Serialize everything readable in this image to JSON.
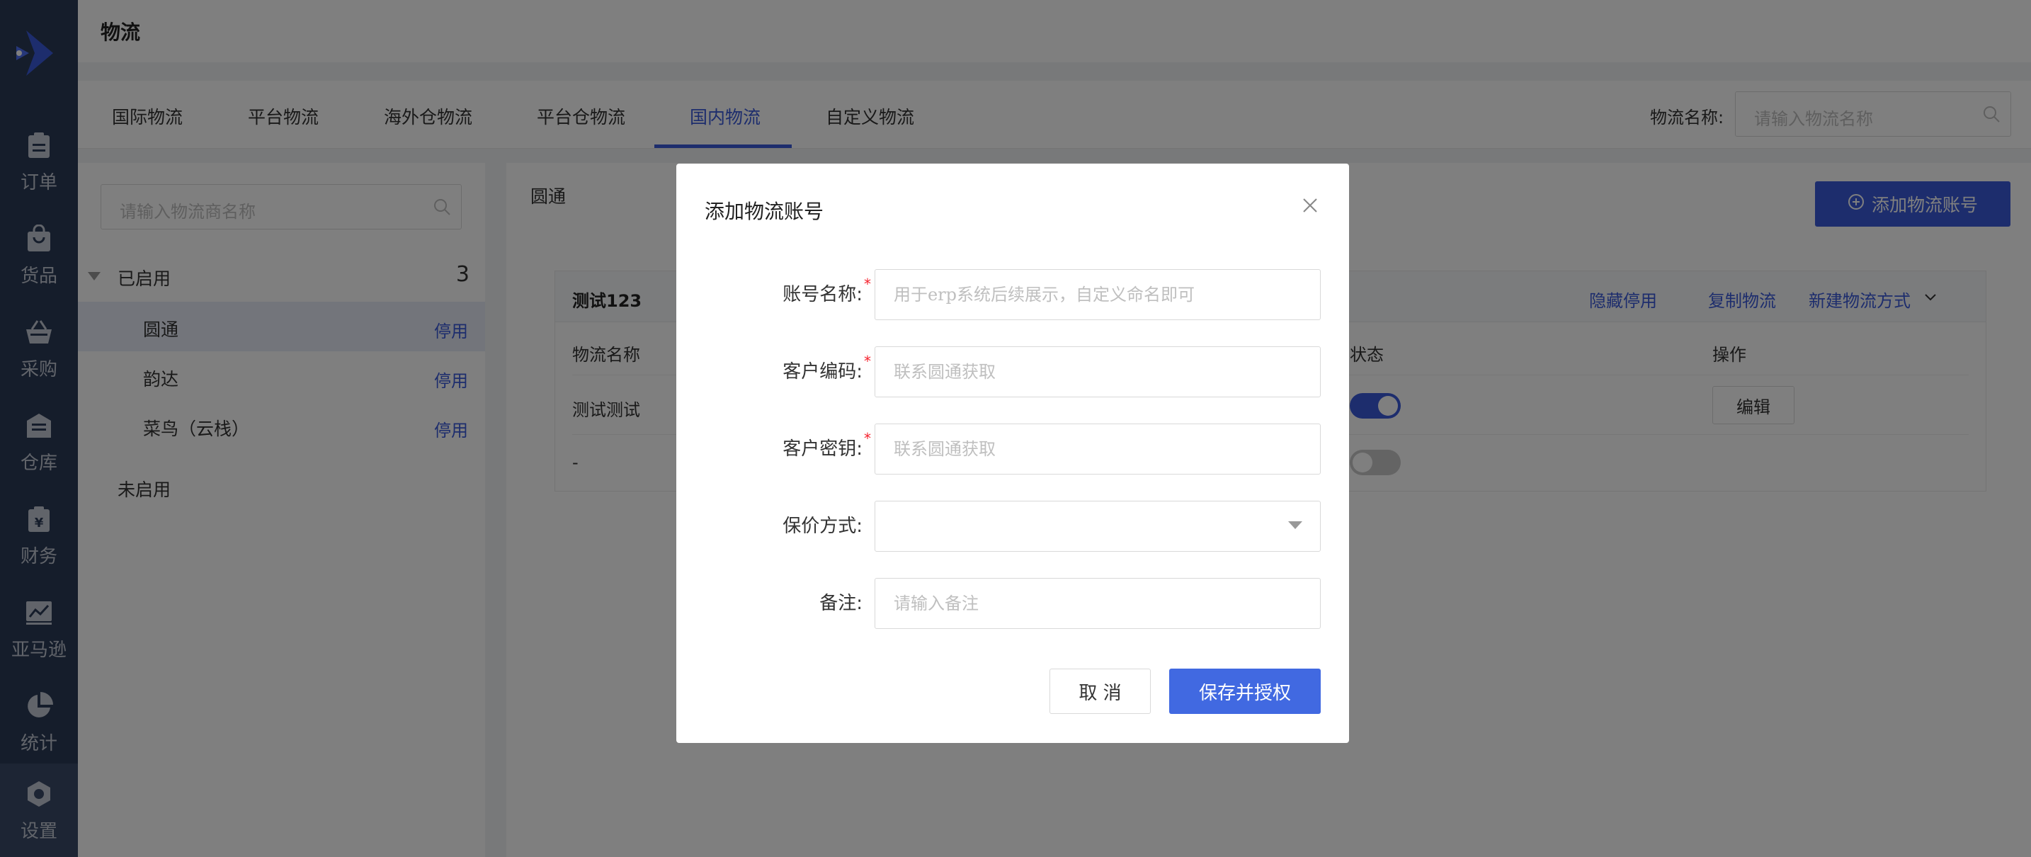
{
  "sidebar": {
    "logo_icon": "app-logo-icon",
    "items": [
      {
        "label": "订单",
        "icon": "clipboard-icon"
      },
      {
        "label": "货品",
        "icon": "shopping-bag-icon"
      },
      {
        "label": "采购",
        "icon": "basket-icon"
      },
      {
        "label": "仓库",
        "icon": "warehouse-icon"
      },
      {
        "label": "财务",
        "icon": "yen-icon"
      },
      {
        "label": "亚马逊",
        "icon": "chart-line-icon"
      },
      {
        "label": "统计",
        "icon": "pie-chart-icon"
      },
      {
        "label": "设置",
        "icon": "gear-icon"
      }
    ]
  },
  "header": {
    "title": "物流"
  },
  "tabs": [
    {
      "label": "国际物流"
    },
    {
      "label": "平台物流"
    },
    {
      "label": "海外仓物流"
    },
    {
      "label": "平台仓物流"
    },
    {
      "label": "国内物流"
    },
    {
      "label": "自定义物流"
    }
  ],
  "search": {
    "label": "物流名称:",
    "placeholder": "请输入物流名称"
  },
  "left_panel": {
    "search_placeholder": "请输入物流商名称",
    "enabled_group": {
      "name": "已启用",
      "count": "3"
    },
    "carriers": [
      {
        "name": "圆通",
        "action": "停用"
      },
      {
        "name": "韵达",
        "action": "停用"
      },
      {
        "name": "菜鸟（云栈）",
        "action": "停用"
      }
    ],
    "disabled_group": {
      "name": "未启用"
    }
  },
  "right_panel": {
    "title": "圆通",
    "add_button": "添加物流账号",
    "account": {
      "name": "测试123",
      "links": [
        "隐藏停用",
        "复制物流",
        "新建物流方式"
      ],
      "columns": [
        "物流名称",
        "状态",
        "操作"
      ],
      "rows": [
        {
          "name": "测试测试",
          "status_on": true,
          "action": "编辑"
        },
        {
          "name": "-",
          "status_on": false,
          "action": ""
        }
      ]
    }
  },
  "modal": {
    "title": "添加物流账号",
    "fields": [
      {
        "label": "账号名称:",
        "required": true,
        "placeholder": "用于erp系统后续展示，自定义命名即可"
      },
      {
        "label": "客户编码:",
        "required": true,
        "placeholder": "联系圆通获取"
      },
      {
        "label": "客户密钥:",
        "required": true,
        "placeholder": "联系圆通获取"
      },
      {
        "label": "保价方式:",
        "required": false,
        "placeholder": ""
      },
      {
        "label": "备注:",
        "required": false,
        "placeholder": "请输入备注"
      }
    ],
    "required_mark": "*",
    "cancel": "取 消",
    "save": "保存并授权"
  }
}
